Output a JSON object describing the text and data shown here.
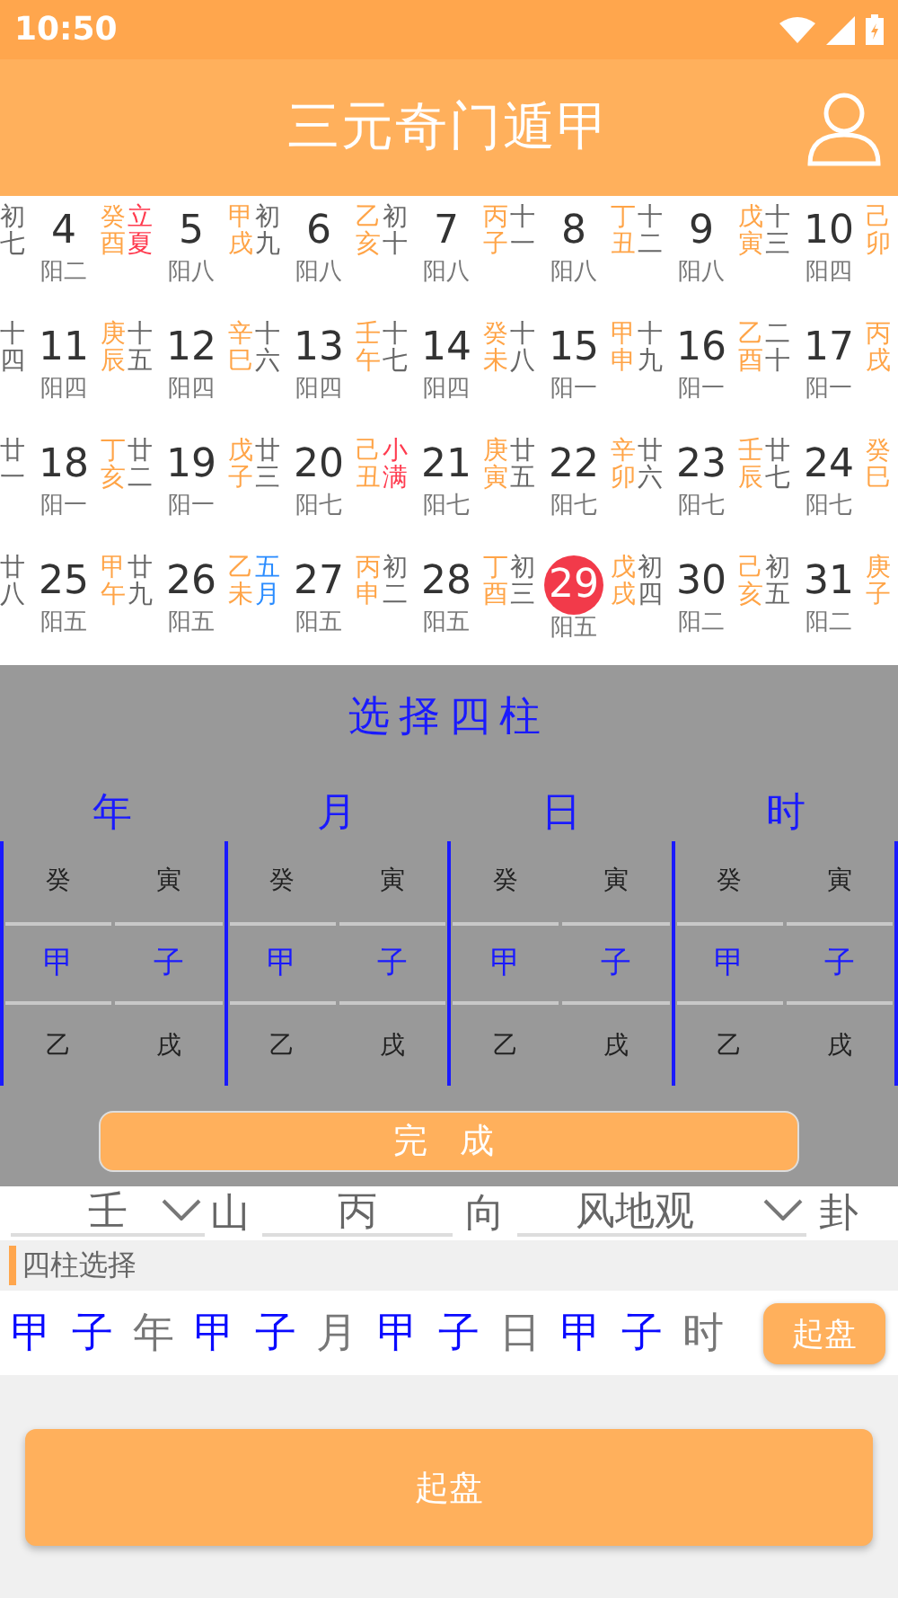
{
  "status_bar": {
    "time": "10:50"
  },
  "header": {
    "title": "三元奇门遁甲"
  },
  "calendar": {
    "rows": [
      {
        "cells": [
          {
            "lunar": "初七",
            "color": "#666666",
            "day": "4",
            "yang": "阳二",
            "selected": false
          },
          {
            "ganzhi": "癸酉",
            "lunar": "立夏",
            "color": "#ff3b4f",
            "day": "5",
            "yang": "阳八",
            "selected": false
          },
          {
            "ganzhi": "甲戌",
            "lunar": "初九",
            "color": "#666666",
            "day": "6",
            "yang": "阳八",
            "selected": false
          },
          {
            "ganzhi": "乙亥",
            "lunar": "初十",
            "color": "#666666",
            "day": "7",
            "yang": "阳八",
            "selected": false
          },
          {
            "ganzhi": "丙子",
            "lunar": "十一",
            "color": "#666666",
            "day": "8",
            "yang": "阳八",
            "selected": false
          },
          {
            "ganzhi": "丁丑",
            "lunar": "十二",
            "color": "#666666",
            "day": "9",
            "yang": "阳八",
            "selected": false
          },
          {
            "ganzhi": "戊寅",
            "lunar": "十三",
            "color": "#666666",
            "day": "10",
            "yang": "阳四",
            "selected": false
          },
          {
            "ganzhi": "己卯"
          }
        ]
      },
      {
        "cells": [
          {
            "lunar": "十四",
            "color": "#666666",
            "day": "11",
            "yang": "阳四",
            "selected": false
          },
          {
            "ganzhi": "庚辰",
            "lunar": "十五",
            "color": "#666666",
            "day": "12",
            "yang": "阳四",
            "selected": false
          },
          {
            "ganzhi": "辛巳",
            "lunar": "十六",
            "color": "#666666",
            "day": "13",
            "yang": "阳四",
            "selected": false
          },
          {
            "ganzhi": "壬午",
            "lunar": "十七",
            "color": "#666666",
            "day": "14",
            "yang": "阳四",
            "selected": false
          },
          {
            "ganzhi": "癸未",
            "lunar": "十八",
            "color": "#666666",
            "day": "15",
            "yang": "阳一",
            "selected": false
          },
          {
            "ganzhi": "甲申",
            "lunar": "十九",
            "color": "#666666",
            "day": "16",
            "yang": "阳一",
            "selected": false
          },
          {
            "ganzhi": "乙酉",
            "lunar": "二十",
            "color": "#666666",
            "day": "17",
            "yang": "阳一",
            "selected": false
          },
          {
            "ganzhi": "丙戌"
          }
        ]
      },
      {
        "cells": [
          {
            "lunar": "廿一",
            "color": "#666666",
            "day": "18",
            "yang": "阳一",
            "selected": false
          },
          {
            "ganzhi": "丁亥",
            "lunar": "廿二",
            "color": "#666666",
            "day": "19",
            "yang": "阳一",
            "selected": false
          },
          {
            "ganzhi": "戊子",
            "lunar": "廿三",
            "color": "#666666",
            "day": "20",
            "yang": "阳七",
            "selected": false
          },
          {
            "ganzhi": "己丑",
            "lunar": "小满",
            "color": "#ff3b4f",
            "day": "21",
            "yang": "阳七",
            "selected": false
          },
          {
            "ganzhi": "庚寅",
            "lunar": "廿五",
            "color": "#666666",
            "day": "22",
            "yang": "阳七",
            "selected": false
          },
          {
            "ganzhi": "辛卯",
            "lunar": "廿六",
            "color": "#666666",
            "day": "23",
            "yang": "阳七",
            "selected": false
          },
          {
            "ganzhi": "壬辰",
            "lunar": "廿七",
            "color": "#666666",
            "day": "24",
            "yang": "阳七",
            "selected": false
          },
          {
            "ganzhi": "癸巳"
          }
        ]
      },
      {
        "cells": [
          {
            "lunar": "廿八",
            "color": "#666666",
            "day": "25",
            "yang": "阳五",
            "selected": false
          },
          {
            "ganzhi": "甲午",
            "lunar": "廿九",
            "color": "#666666",
            "day": "26",
            "yang": "阳五",
            "selected": false
          },
          {
            "ganzhi": "乙未",
            "lunar": "五月",
            "color": "#2a8cff",
            "day": "27",
            "yang": "阳五",
            "selected": false
          },
          {
            "ganzhi": "丙申",
            "lunar": "初二",
            "color": "#666666",
            "day": "28",
            "yang": "阳五",
            "selected": false
          },
          {
            "ganzhi": "丁酉",
            "lunar": "初三",
            "color": "#666666",
            "day": "29",
            "yang": "阳五",
            "selected": true
          },
          {
            "ganzhi": "戊戌",
            "lunar": "初四",
            "color": "#666666",
            "day": "30",
            "yang": "阳二",
            "selected": false
          },
          {
            "ganzhi": "己亥",
            "lunar": "初五",
            "color": "#666666",
            "day": "31",
            "yang": "阳二",
            "selected": false
          },
          {
            "ganzhi": "庚子"
          }
        ]
      }
    ]
  },
  "picker": {
    "title": "选择四柱",
    "pillars": [
      {
        "label": "年",
        "wheels": [
          {
            "items": [
              {
                "text": "癸",
                "selected": false
              },
              {
                "text": "甲",
                "selected": true
              },
              {
                "text": "乙",
                "selected": false
              }
            ]
          },
          {
            "items": [
              {
                "text": "寅",
                "selected": false
              },
              {
                "text": "子",
                "selected": true
              },
              {
                "text": "戌",
                "selected": false
              }
            ]
          }
        ]
      },
      {
        "label": "月",
        "wheels": [
          {
            "items": [
              {
                "text": "癸",
                "selected": false
              },
              {
                "text": "甲",
                "selected": true
              },
              {
                "text": "乙",
                "selected": false
              }
            ]
          },
          {
            "items": [
              {
                "text": "寅",
                "selected": false
              },
              {
                "text": "子",
                "selected": true
              },
              {
                "text": "戌",
                "selected": false
              }
            ]
          }
        ]
      },
      {
        "label": "日",
        "wheels": [
          {
            "items": [
              {
                "text": "癸",
                "selected": false
              },
              {
                "text": "甲",
                "selected": true
              },
              {
                "text": "乙",
                "selected": false
              }
            ]
          },
          {
            "items": [
              {
                "text": "寅",
                "selected": false
              },
              {
                "text": "子",
                "selected": true
              },
              {
                "text": "戌",
                "selected": false
              }
            ]
          }
        ]
      },
      {
        "label": "时",
        "wheels": [
          {
            "items": [
              {
                "text": "癸",
                "selected": false
              },
              {
                "text": "甲",
                "selected": true
              },
              {
                "text": "乙",
                "selected": false
              }
            ]
          },
          {
            "items": [
              {
                "text": "寅",
                "selected": false
              },
              {
                "text": "子",
                "selected": true
              },
              {
                "text": "戌",
                "selected": false
              }
            ]
          }
        ]
      }
    ],
    "done_button": "完 成"
  },
  "direction_row": {
    "mountain": "壬",
    "mountain_label": "山",
    "facing": "丙",
    "facing_label": "向",
    "gua": "风地观",
    "gua_label": "卦"
  },
  "section": {
    "title": "四柱选择"
  },
  "summary": {
    "pillars": [
      {
        "stem": "甲",
        "branch": "子",
        "unit": "年"
      },
      {
        "stem": "甲",
        "branch": "子",
        "unit": "月"
      },
      {
        "stem": "甲",
        "branch": "子",
        "unit": "日"
      },
      {
        "stem": "甲",
        "branch": "子",
        "unit": "时"
      }
    ],
    "button": "起盘"
  },
  "main_button": "起盘"
}
